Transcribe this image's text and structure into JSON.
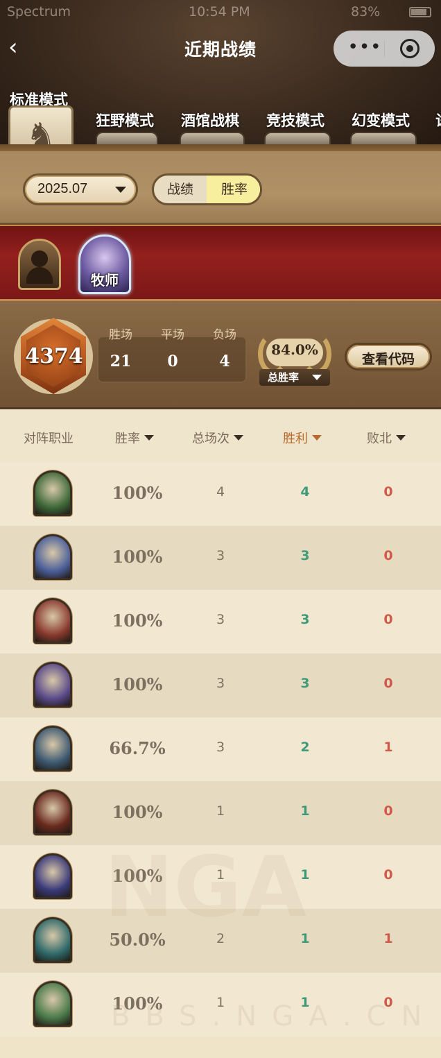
{
  "status_bar": {
    "carrier": "Spectrum",
    "time": "10:54 PM",
    "battery": "83%"
  },
  "header": {
    "title": "近期战绩"
  },
  "modes": [
    {
      "label": "标准模式",
      "active": true
    },
    {
      "label": "狂野模式"
    },
    {
      "label": "酒馆战棋"
    },
    {
      "label": "竞技模式"
    },
    {
      "label": "幻变模式"
    },
    {
      "label": "试"
    }
  ],
  "filter": {
    "date": "2025.07",
    "seg_record": "战绩",
    "seg_winrate": "胜率",
    "seg_selected": "胜率"
  },
  "classes": {
    "selected_label": "牧师"
  },
  "stats": {
    "rating": "4374",
    "headers": [
      "胜场",
      "平场",
      "负场"
    ],
    "values": [
      "21",
      "0",
      "4"
    ],
    "winrate": "84.0%",
    "winrate_label": "总胜率",
    "code_button": "查看代码"
  },
  "table": {
    "columns": [
      "对阵职业",
      "胜率",
      "总场次",
      "胜利",
      "败北"
    ],
    "sorted_column": "胜利",
    "rows": [
      {
        "winrate": "100%",
        "total": "4",
        "wins": "4",
        "losses": "0",
        "portrait": "#3f6a3a"
      },
      {
        "winrate": "100%",
        "total": "3",
        "wins": "3",
        "losses": "0",
        "portrait": "#4b5f9a"
      },
      {
        "winrate": "100%",
        "total": "3",
        "wins": "3",
        "losses": "0",
        "portrait": "#8a3a2e"
      },
      {
        "winrate": "100%",
        "total": "3",
        "wins": "3",
        "losses": "0",
        "portrait": "#5a4a8a"
      },
      {
        "winrate": "66.7%",
        "total": "3",
        "wins": "2",
        "losses": "1",
        "portrait": "#3e5a72"
      },
      {
        "winrate": "100%",
        "total": "1",
        "wins": "1",
        "losses": "0",
        "portrait": "#6a2a1e"
      },
      {
        "winrate": "100%",
        "total": "1",
        "wins": "1",
        "losses": "0",
        "portrait": "#3a3a7a"
      },
      {
        "winrate": "50.0%",
        "total": "2",
        "wins": "1",
        "losses": "1",
        "portrait": "#2f6a6a"
      },
      {
        "winrate": "100%",
        "total": "1",
        "wins": "1",
        "losses": "0",
        "portrait": "#4a7a4a"
      }
    ]
  },
  "watermark": {
    "main": "NGA",
    "sub": "BBS.NGA.CN"
  }
}
